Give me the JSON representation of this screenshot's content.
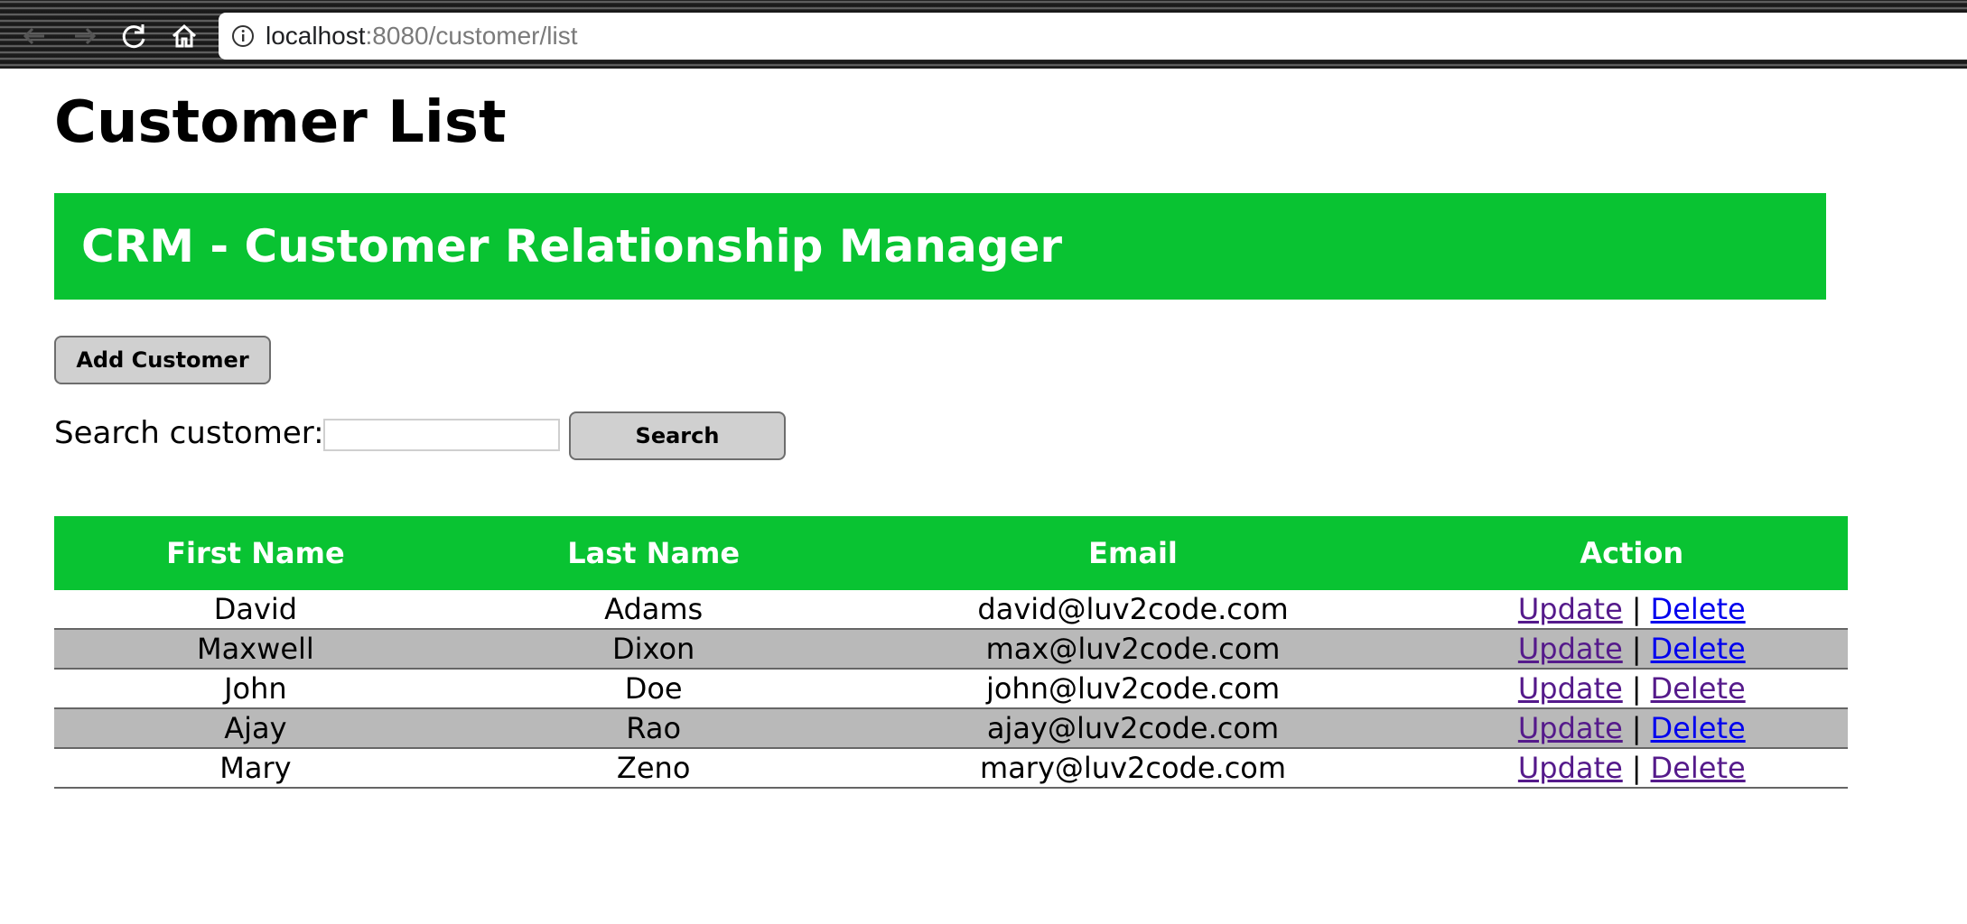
{
  "browser": {
    "url_host": "localhost",
    "url_path": ":8080/customer/list"
  },
  "page": {
    "title": "Customer List"
  },
  "header": {
    "title": "CRM - Customer Relationship Manager"
  },
  "actions": {
    "add_customer_label": "Add Customer",
    "search_label": "Search customer:",
    "search_value": "",
    "search_button_label": "Search"
  },
  "table": {
    "columns": [
      "First Name",
      "Last Name",
      "Email",
      "Action"
    ],
    "update_label": "Update",
    "delete_label": "Delete",
    "separator": "|",
    "rows": [
      {
        "first": "David",
        "last": "Adams",
        "email": "david@luv2code.com"
      },
      {
        "first": "Maxwell",
        "last": "Dixon",
        "email": "max@luv2code.com"
      },
      {
        "first": "John",
        "last": "Doe",
        "email": "john@luv2code.com"
      },
      {
        "first": "Ajay",
        "last": "Rao",
        "email": "ajay@luv2code.com"
      },
      {
        "first": "Mary",
        "last": "Zeno",
        "email": "mary@luv2code.com"
      }
    ]
  },
  "colors": {
    "accent_green": "#09c332",
    "alt_row": "#b9b9b9"
  }
}
